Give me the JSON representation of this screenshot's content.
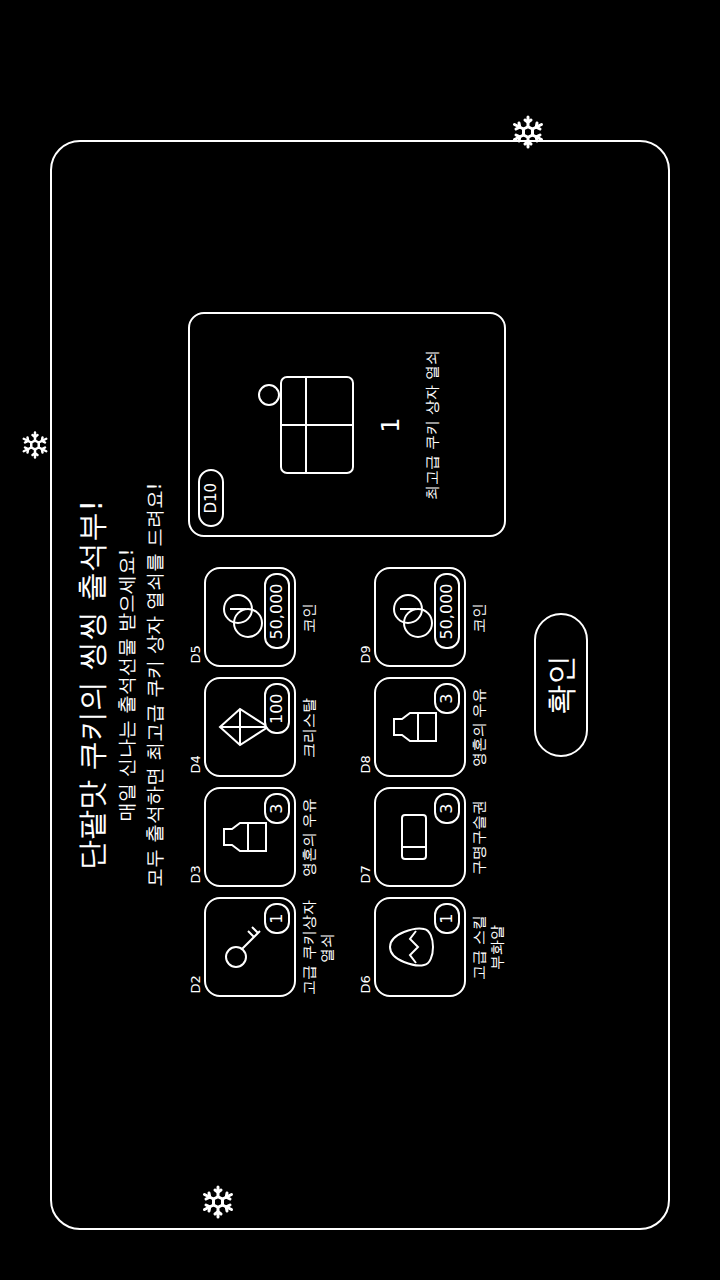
{
  "title": "단팥맛 쿠키의 씽씽 출석부!",
  "subtitle": [
    "매일 신나는 출석선물 받으세요!",
    "모두 출석하면 최고급 쿠키 상자 열쇠를 드려요!"
  ],
  "days": [
    {
      "day": "D2",
      "count": "1",
      "name": "고급 쿠키상자 열쇠",
      "kind": "key"
    },
    {
      "day": "D3",
      "count": "3",
      "name": "영혼의 우유",
      "kind": "milk"
    },
    {
      "day": "D4",
      "count": "100",
      "name": "크리스탈",
      "kind": "crystal"
    },
    {
      "day": "D5",
      "count": "50,000",
      "name": "코인",
      "kind": "coin"
    },
    {
      "day": "D6",
      "count": "1",
      "name": "고급 스킬 부화알",
      "kind": "egg"
    },
    {
      "day": "D7",
      "count": "3",
      "name": "구명구슬권",
      "kind": "ticket"
    },
    {
      "day": "D8",
      "count": "3",
      "name": "영혼의 우유",
      "kind": "milk"
    },
    {
      "day": "D9",
      "count": "50,000",
      "name": "코인",
      "kind": "coin"
    }
  ],
  "grand_prize": {
    "day": "D10",
    "count": "1",
    "name": "최고급 쿠키 상자 열쇠"
  },
  "confirm_button": "확인"
}
